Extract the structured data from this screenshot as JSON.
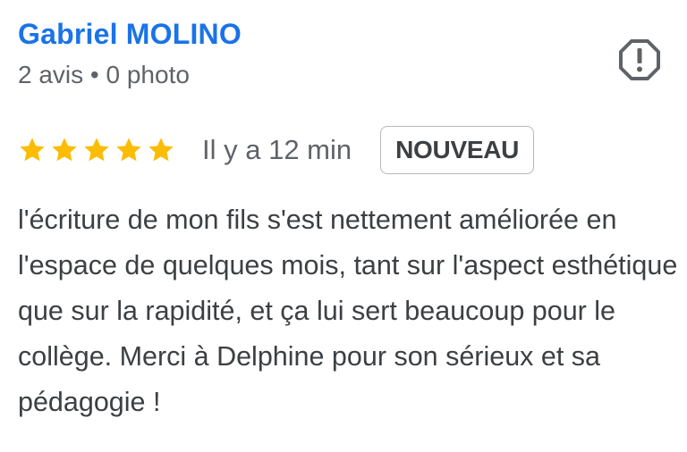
{
  "review": {
    "reviewer_name": "Gabriel MOLINO",
    "reviewer_meta": "2 avis • 0 photo",
    "rating": 5,
    "rating_max": 5,
    "time_ago": "Il y a 12 min",
    "badge": "NOUVEAU",
    "text": "l'écriture de mon fils s'est nettement améliorée en l'espace de quelques mois, tant sur l'aspect esthétique que sur la rapidité, et ça lui sert beaucoup pour le collège. Merci à Delphine pour son sérieux et sa pédagogie !"
  },
  "icons": {
    "star": "star-icon",
    "report": "report-flag-icon"
  },
  "colors": {
    "name": "#1a73e8",
    "star": "#fbbc04",
    "meta": "#5f6368",
    "text": "#3c4043",
    "badge_border": "#b8b8b8"
  }
}
